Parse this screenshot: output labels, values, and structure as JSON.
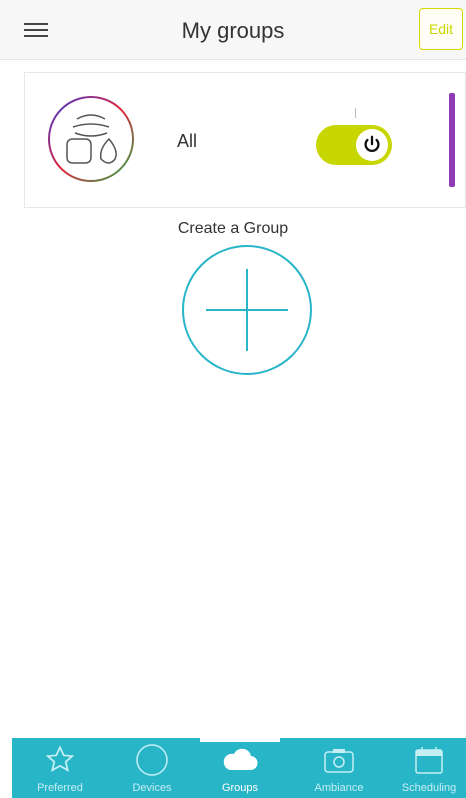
{
  "header": {
    "title": "My groups",
    "edit_label": "Edit"
  },
  "group_card": {
    "name": "All",
    "power_on": true
  },
  "create": {
    "label": "Create a Group"
  },
  "tabs": [
    {
      "label": "Preferred",
      "icon": "star-icon",
      "active": false
    },
    {
      "label": "Devices",
      "icon": "circle-icon",
      "active": false
    },
    {
      "label": "Groups",
      "icon": "cloud-icon",
      "active": true
    },
    {
      "label": "Ambiance",
      "icon": "camera-icon",
      "active": false
    },
    {
      "label": "Scheduling",
      "icon": "calendar-icon",
      "active": false
    }
  ],
  "colors": {
    "accent_yellow": "#c8d600",
    "accent_purple": "#8f3bb3",
    "tabbar_cyan": "#28b5c7"
  }
}
